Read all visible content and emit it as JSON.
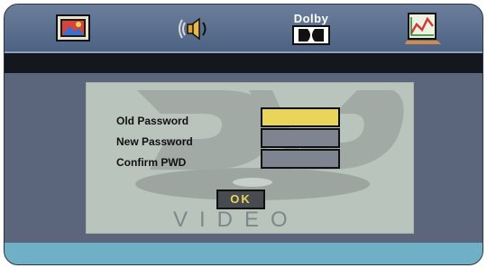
{
  "topbar": {
    "icons": [
      "screen-settings-icon",
      "speaker-audio-icon",
      "dolby-digital-icon",
      "preferences-chart-icon"
    ],
    "dolby_label": "Dolby"
  },
  "panel": {
    "background_logo_text": "VIDEO",
    "fields": [
      {
        "label": "Old Password",
        "value": "",
        "state": "active"
      },
      {
        "label": "New Password",
        "value": "",
        "state": "idle"
      },
      {
        "label": "Confirm PWD",
        "value": "",
        "state": "idle"
      }
    ],
    "ok_label": "OK"
  },
  "colors": {
    "accent_yellow": "#e9d55a",
    "panel_bg": "#b9c4bd",
    "bottom_bar": "#6fb0c6",
    "top_bar": "#5d7090"
  }
}
